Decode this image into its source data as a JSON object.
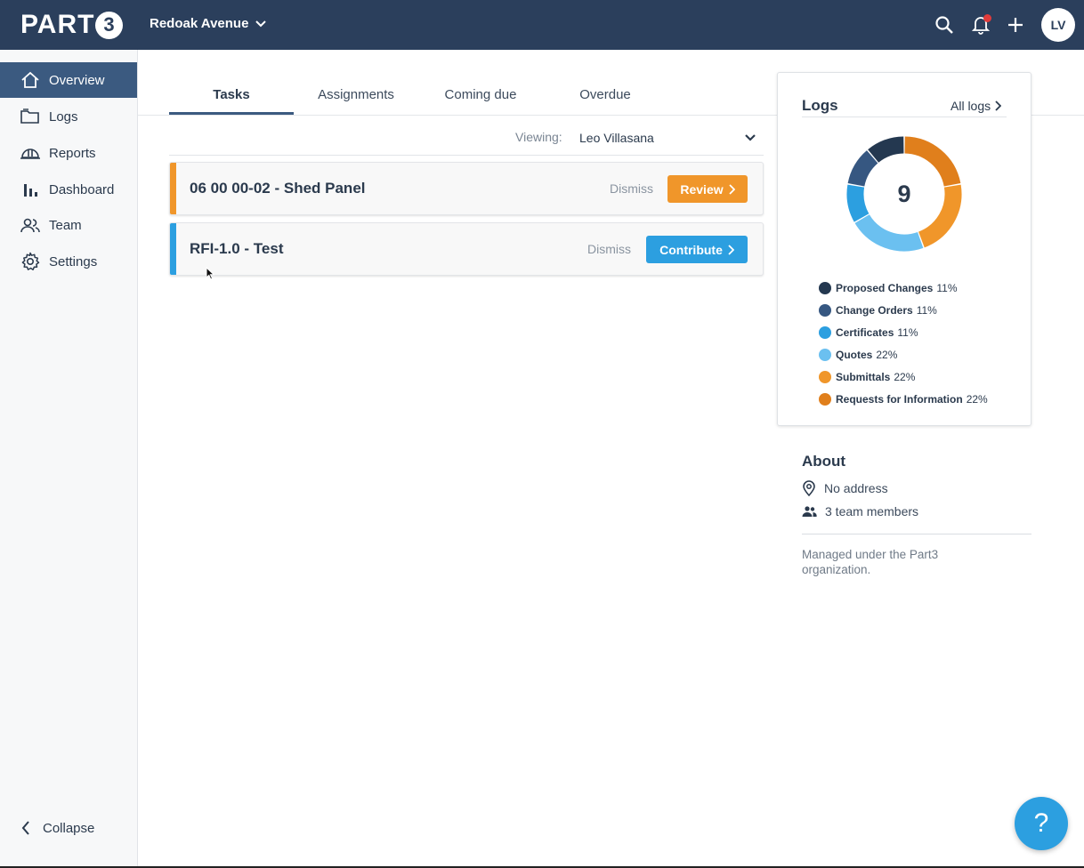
{
  "header": {
    "logo_text": "PART",
    "logo_badge": "3",
    "project_name": "Redoak Avenue",
    "avatar_initials": "LV"
  },
  "sidebar": {
    "items": [
      {
        "label": "Overview",
        "icon": "home-icon",
        "active": true
      },
      {
        "label": "Logs",
        "icon": "folder-icon"
      },
      {
        "label": "Reports",
        "icon": "hardhat-icon"
      },
      {
        "label": "Dashboard",
        "icon": "bar-chart-icon"
      },
      {
        "label": "Team",
        "icon": "team-icon"
      },
      {
        "label": "Settings",
        "icon": "gear-icon"
      }
    ],
    "collapse_label": "Collapse"
  },
  "tabs": [
    {
      "label": "Tasks",
      "active": true
    },
    {
      "label": "Assignments"
    },
    {
      "label": "Coming due"
    },
    {
      "label": "Overdue"
    }
  ],
  "viewing": {
    "label": "Viewing:",
    "value": "Leo Villasana"
  },
  "tasks": [
    {
      "title": "06 00 00-02 - Shed Panel",
      "dismiss": "Dismiss",
      "action": "Review",
      "color": "#f0962a"
    },
    {
      "title": "RFI-1.0 - Test",
      "dismiss": "Dismiss",
      "action": "Contribute",
      "color": "#2c9fe0"
    }
  ],
  "logs": {
    "title": "Logs",
    "all_logs": "All logs",
    "total": "9",
    "legend": [
      {
        "name": "Proposed Changes",
        "pct": "11%",
        "fraction": 0.111,
        "color": "#243850"
      },
      {
        "name": "Change Orders",
        "pct": "11%",
        "fraction": 0.111,
        "color": "#365781"
      },
      {
        "name": "Certificates",
        "pct": "11%",
        "fraction": 0.111,
        "color": "#2c9fe0"
      },
      {
        "name": "Quotes",
        "pct": "22%",
        "fraction": 0.222,
        "color": "#6bc0f0"
      },
      {
        "name": "Submittals",
        "pct": "22%",
        "fraction": 0.222,
        "color": "#f0962a"
      },
      {
        "name": "Requests for Information",
        "pct": "22%",
        "fraction": 0.222,
        "color": "#e07f1c"
      }
    ]
  },
  "about": {
    "title": "About",
    "address": "No address",
    "team": "3 team members",
    "note": "Managed under the Part3 organization."
  },
  "help_label": "?"
}
